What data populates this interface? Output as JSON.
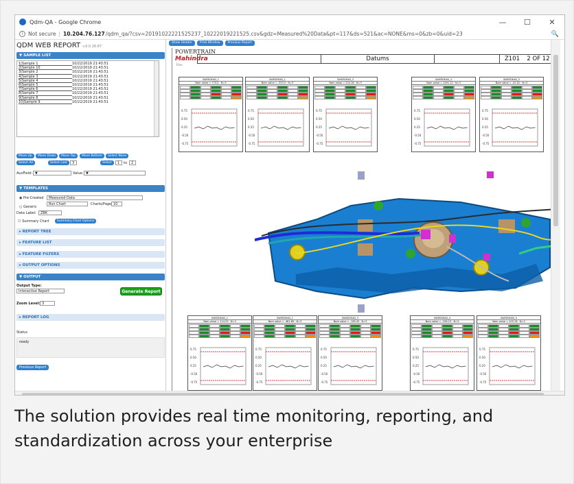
{
  "browser": {
    "window_title": "Qdm-QA - Google Chrome",
    "security_label": "Not secure",
    "host": "10.204.76.127",
    "url_rest": "/qdm_qa/?csv=20191022221525237_10222019221525.csv&gdz=Measured%20Data&pt=117&ds=521&ac=NONE&ms=0&zb=0&uid=23",
    "minimize": "—",
    "restore": "☐",
    "close": "✕"
  },
  "left": {
    "app_title": "QDM WEB REPORT",
    "version": "v.6.0.26.87",
    "sample_list_header": "▼  SAMPLE LIST",
    "samples": [
      {
        "name": "1|Sample 1",
        "date": "10/22/2019 21:43:51"
      },
      {
        "name": "2|Sample 10",
        "date": "10/22/2019 21:43:51"
      },
      {
        "name": "3|Sample 2",
        "date": "10/22/2019 21:43:51"
      },
      {
        "name": "4|Sample 3",
        "date": "10/22/2019 21:43:51"
      },
      {
        "name": "5|Sample 4",
        "date": "10/22/2019 21:43:51"
      },
      {
        "name": "6|Sample 5",
        "date": "10/22/2019 21:43:51"
      },
      {
        "name": "7|Sample 6",
        "date": "10/22/2019 21:43:51"
      },
      {
        "name": "8|Sample 7",
        "date": "10/22/2019 21:43:51"
      },
      {
        "name": "9|Sample 8",
        "date": "10/22/2019 21:43:51"
      },
      {
        "name": "10|Sample 9",
        "date": "10/22/2019 21:43:51"
      }
    ],
    "buttons_row1": [
      "Move Up",
      "Move Down",
      "Move Top",
      "Move Bottom",
      "Select None"
    ],
    "buttons_row2": [
      "Select All",
      "Select Last",
      "Select"
    ],
    "select_last_value": "3",
    "select_from": "1",
    "select_to_label": "to",
    "select_to": "2",
    "aux_field_label": "AuxField:",
    "value_label": "Value:",
    "templates_header": "▼  TEMPLATES",
    "precreated_label": "Pre-Created",
    "precreated_value": "Measured Data",
    "chart_type_value": "Run Chart",
    "charts_page_label": "Charts/Page",
    "charts_page_value": "10",
    "generic_label": "Generic",
    "data_label_label": "Data Label:",
    "data_label_value": "ZBK",
    "summary_chart_label": "Summary Chart",
    "summary_chart_options": "Summary Chart Options",
    "collapsed_sections": [
      "▸  REPORT TREE",
      "▸  FEATURE LIST",
      "▸  FEATURE FILTERS",
      "▸  OUTPUT OPTIONS"
    ],
    "output_header": "▼  OUTPUT",
    "output_type_label": "Output Type:",
    "output_type_value": "Interactive Report",
    "generate_report": "Generate Report",
    "zoom_level_label": "Zoom Level:",
    "zoom_level_value": "3",
    "report_log_header": "▸  REPORT LOG",
    "status_label": "Status",
    "status_value": "ready",
    "previous_report": "Previous Report"
  },
  "report": {
    "toolbar": [
      "Show Header",
      "Print Window",
      "Previous Report"
    ],
    "logo_line1": "POWERTRAIN",
    "logo_line2": "Mahindra",
    "logo_line3": "Rise",
    "header_title": "Datums",
    "header_code": "Z101",
    "header_page": "2 OF 12",
    "top_panels": [
      {
        "title": "SWEEDEAD_1",
        "nom": "Nom value = 774.5 · N=3"
      },
      {
        "title": "SWEEDEAD_1",
        "nom": "Nom value = -333.5 · N=3"
      },
      {
        "title": "SWEEDEAD_3",
        "nom": "Nom value = 220.18 · N=3"
      },
      {
        "title": "SWEEDEAD_4",
        "nom": "Nom value = 1291.12 · N=3"
      },
      {
        "title": "SWEEDEAD_5",
        "nom": "Nom value = -41.02 · N=3"
      }
    ],
    "bottom_panels": [
      {
        "title": "SWEEDEAD_1",
        "nom": "Nom value = 114.25 · N=3"
      },
      {
        "title": "SWEEDEAD_1",
        "nom": "Nom value = -481.69 · N=3"
      },
      {
        "title": "SWEEDEAD_3",
        "nom": "Nom value = -128.45 · N=3"
      },
      {
        "title": "SWEEDEAD_4",
        "nom": "Nom value = -228.15 · N=3"
      },
      {
        "title": "SWEEDEAD_5",
        "nom": "Nom value = 103.16 · N=3"
      }
    ],
    "axis_ticks": [
      "0.75",
      "0.50",
      "0.25",
      "-0.50",
      "-0.75"
    ]
  },
  "caption": "The solution provides real time monitoring, reporting, and standardization across your enterprise",
  "colors": {
    "accent": "#2f7fd0",
    "good": "#1a8c2c",
    "bad": "#e11a1a",
    "warn": "#f08c12",
    "part": "#1a7fd0"
  }
}
